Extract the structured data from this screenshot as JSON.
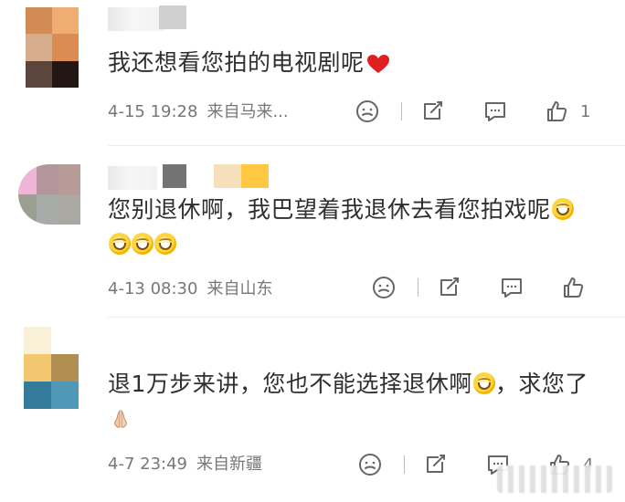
{
  "comments": [
    {
      "text": "我还想看您拍的电视剧呢",
      "trailing_icon": "heart-icon",
      "time": "4-15 19:28",
      "location": "来自马来...",
      "like_count": "1",
      "avatar_colors": [
        "#d38b55",
        "#efad73",
        "#d7ad8e",
        "#db8c52",
        "#5b453c",
        "#231713"
      ]
    },
    {
      "text_before_emojis": "您别退休啊，我巴望着我退休去看您拍戏呢",
      "emoji_icons": [
        "crying-laughing-face-icon",
        "grinning-face-icon",
        "grinning-face-icon",
        "grinning-face-icon"
      ],
      "time": "4-13 08:30",
      "location": "来自山东",
      "avatar_colors": [
        "#f0b4d7",
        "#b3959c",
        "#b79b96",
        "#9b9f8f",
        "#a8aca8",
        "#aaa8a3"
      ]
    },
    {
      "text_before_emoji": "退1万步来讲，您也不能选择退休啊",
      "emoji_icon": "crying-laughing-face-icon",
      "text_after_emoji": "，求您了",
      "trailing_icon": "folded-hands-icon",
      "time": "4-7 23:49",
      "location": "来自新疆",
      "like_count": "4",
      "avatar_colors": [
        "#f8f0d7",
        "#ffffff",
        "#f3c770",
        "#b18e51",
        "#337a9b",
        "#4f98b7"
      ]
    }
  ],
  "icons": {
    "react": "neutral-face-icon",
    "share": "share-icon",
    "reply": "comment-icon",
    "like": "thumbs-up-icon"
  }
}
